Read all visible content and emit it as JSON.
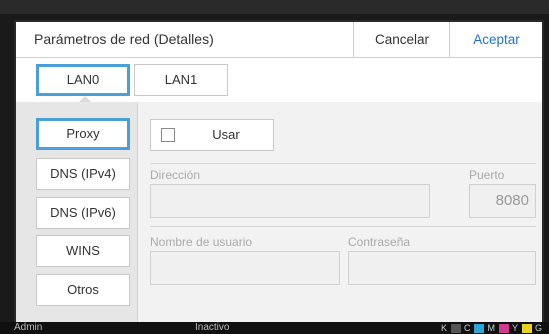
{
  "dialog": {
    "title": "Parámetros de red (Detalles)",
    "cancel_label": "Cancelar",
    "accept_label": "Aceptar"
  },
  "tabs": [
    {
      "label": "LAN0",
      "selected": true
    },
    {
      "label": "LAN1",
      "selected": false
    }
  ],
  "sidebar": {
    "items": [
      {
        "label": "Proxy",
        "selected": true
      },
      {
        "label": "DNS (IPv4)",
        "selected": false
      },
      {
        "label": "DNS (IPv6)",
        "selected": false
      },
      {
        "label": "WINS",
        "selected": false
      },
      {
        "label": "Otros",
        "selected": false
      }
    ]
  },
  "proxy": {
    "use_label": "Usar",
    "use_checked": false,
    "address_label": "Dirección",
    "address_value": "",
    "port_label": "Puerto",
    "port_value": "8080",
    "username_label": "Nombre de usuario",
    "username_value": "",
    "password_label": "Contraseña",
    "password_value": ""
  },
  "status_bar": {
    "user": "Admin",
    "state": "Inactivo",
    "ink_labels": [
      "K",
      "C",
      "M",
      "Y",
      "G"
    ]
  },
  "colors": {
    "accent": "#4a9fd8",
    "accept_text": "#1a73d1"
  }
}
